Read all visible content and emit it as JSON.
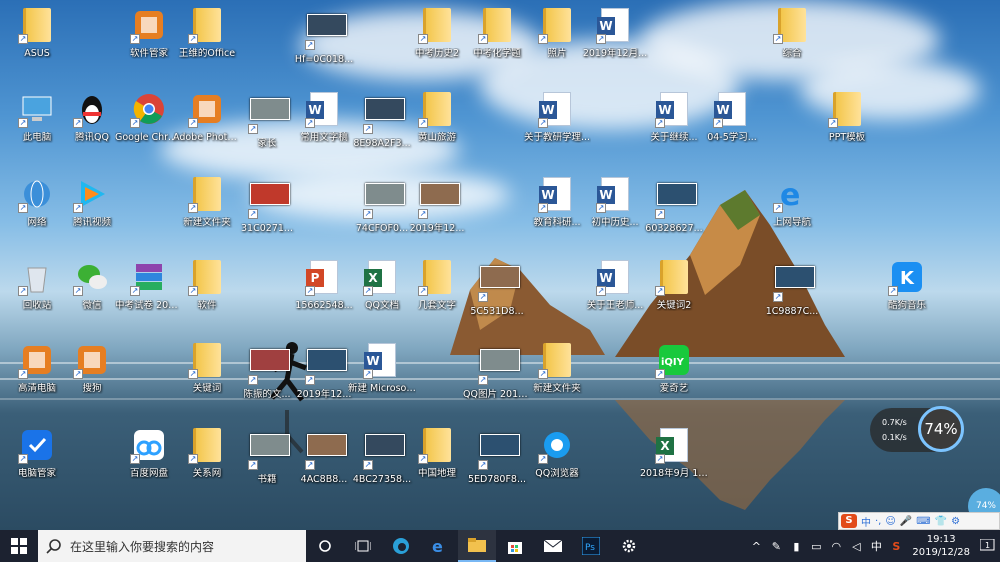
{
  "desktop": {
    "icons": [
      {
        "label": "ASUS",
        "type": "user"
      },
      {
        "label": "软件管家",
        "type": "app"
      },
      {
        "label": "王维的Office",
        "type": "folder"
      },
      {
        "label": "Hf=0C018...",
        "type": "thumb"
      },
      {
        "label": "中考历史2",
        "type": "folder"
      },
      {
        "label": "中考化学题",
        "type": "folder"
      },
      {
        "label": "照片",
        "type": "folder"
      },
      {
        "label": "2019年12月...",
        "type": "word"
      },
      {
        "label": "综合",
        "type": "folder"
      },
      {
        "label": "此电脑",
        "type": "pc"
      },
      {
        "label": "腾讯QQ",
        "type": "qq"
      },
      {
        "label": "Google Chrome",
        "type": "chrome"
      },
      {
        "label": "Adobe Photosho...",
        "type": "app"
      },
      {
        "label": "家长",
        "type": "thumb"
      },
      {
        "label": "常用文字稿",
        "type": "word"
      },
      {
        "label": "8E98A2F3...",
        "type": "thumb"
      },
      {
        "label": "黄山旅游",
        "type": "folder"
      },
      {
        "label": "关于教研学理...",
        "type": "word"
      },
      {
        "label": "关于继续...",
        "type": "word"
      },
      {
        "label": "04-5学习...",
        "type": "word"
      },
      {
        "label": "PPT模板",
        "type": "folder"
      },
      {
        "label": "网络",
        "type": "network"
      },
      {
        "label": "腾讯视频",
        "type": "video"
      },
      {
        "label": "新建文件夹",
        "type": "folder"
      },
      {
        "label": "31C0271...",
        "type": "thumb"
      },
      {
        "label": "74CFOF0...",
        "type": "thumb"
      },
      {
        "label": "2019年12...",
        "type": "thumb"
      },
      {
        "label": "教育科研...",
        "type": "word"
      },
      {
        "label": "初中历史...",
        "type": "word"
      },
      {
        "label": "60328627...",
        "type": "thumb"
      },
      {
        "label": "上网导航",
        "type": "ie"
      },
      {
        "label": "回收站",
        "type": "bin"
      },
      {
        "label": "微信",
        "type": "wechat"
      },
      {
        "label": "中考试卷 2019 202...",
        "type": "winrar"
      },
      {
        "label": "软件",
        "type": "folder"
      },
      {
        "label": "15662548...",
        "type": "ppt"
      },
      {
        "label": "QQ文档",
        "type": "excel"
      },
      {
        "label": "几套文字",
        "type": "folder"
      },
      {
        "label": "5C531D8...",
        "type": "thumb"
      },
      {
        "label": "关于王老师...",
        "type": "word"
      },
      {
        "label": "关键词2",
        "type": "folder"
      },
      {
        "label": "1C9887C...",
        "type": "thumb"
      },
      {
        "label": "酷狗音乐",
        "type": "kugou"
      },
      {
        "label": "高清电脑",
        "type": "app"
      },
      {
        "label": "搜狗",
        "type": "app"
      },
      {
        "label": "关键词",
        "type": "folder"
      },
      {
        "label": "陈振的文...",
        "type": "thumb"
      },
      {
        "label": "2019年12...",
        "type": "thumb"
      },
      {
        "label": "新建 Microsof...",
        "type": "word"
      },
      {
        "label": "QQ图片 2019122...",
        "type": "thumb"
      },
      {
        "label": "新建文件夹",
        "type": "folder"
      },
      {
        "label": "爱奇艺",
        "type": "iqiyi"
      },
      {
        "label": "电脑管家",
        "type": "guard"
      },
      {
        "label": "百度网盘",
        "type": "baidu"
      },
      {
        "label": "关系网",
        "type": "folder"
      },
      {
        "label": "书籍",
        "type": "thumb"
      },
      {
        "label": "4AC8B8...",
        "type": "thumb"
      },
      {
        "label": "4BC27358...",
        "type": "thumb"
      },
      {
        "label": "中国地理",
        "type": "folder"
      },
      {
        "label": "5ED780F8...",
        "type": "thumb"
      },
      {
        "label": "QQ浏览器",
        "type": "qqbrowser"
      },
      {
        "label": "2018年9月 12月 (1)",
        "type": "excel"
      }
    ]
  },
  "speed_widget": {
    "up": "0.7K/s",
    "down": "0.1K/s",
    "percent": "74%"
  },
  "corner_ball": {
    "percent": "74%"
  },
  "ime": {
    "logo": "S",
    "lang": "中",
    "items": [
      "·,",
      "☺",
      "🎤",
      "⌨",
      "👕",
      "⚙"
    ]
  },
  "taskbar": {
    "search_placeholder": "在这里输入你要搜索的内容",
    "apps": [
      "cortana",
      "task-view",
      "edge-new",
      "ie",
      "file-explorer",
      "store",
      "mail",
      "photoshop",
      "settings"
    ],
    "tray": {
      "chevron": "^",
      "ime_lang": "中",
      "time": "19:13",
      "date": "2019/12/28",
      "notification_count": "1"
    }
  }
}
